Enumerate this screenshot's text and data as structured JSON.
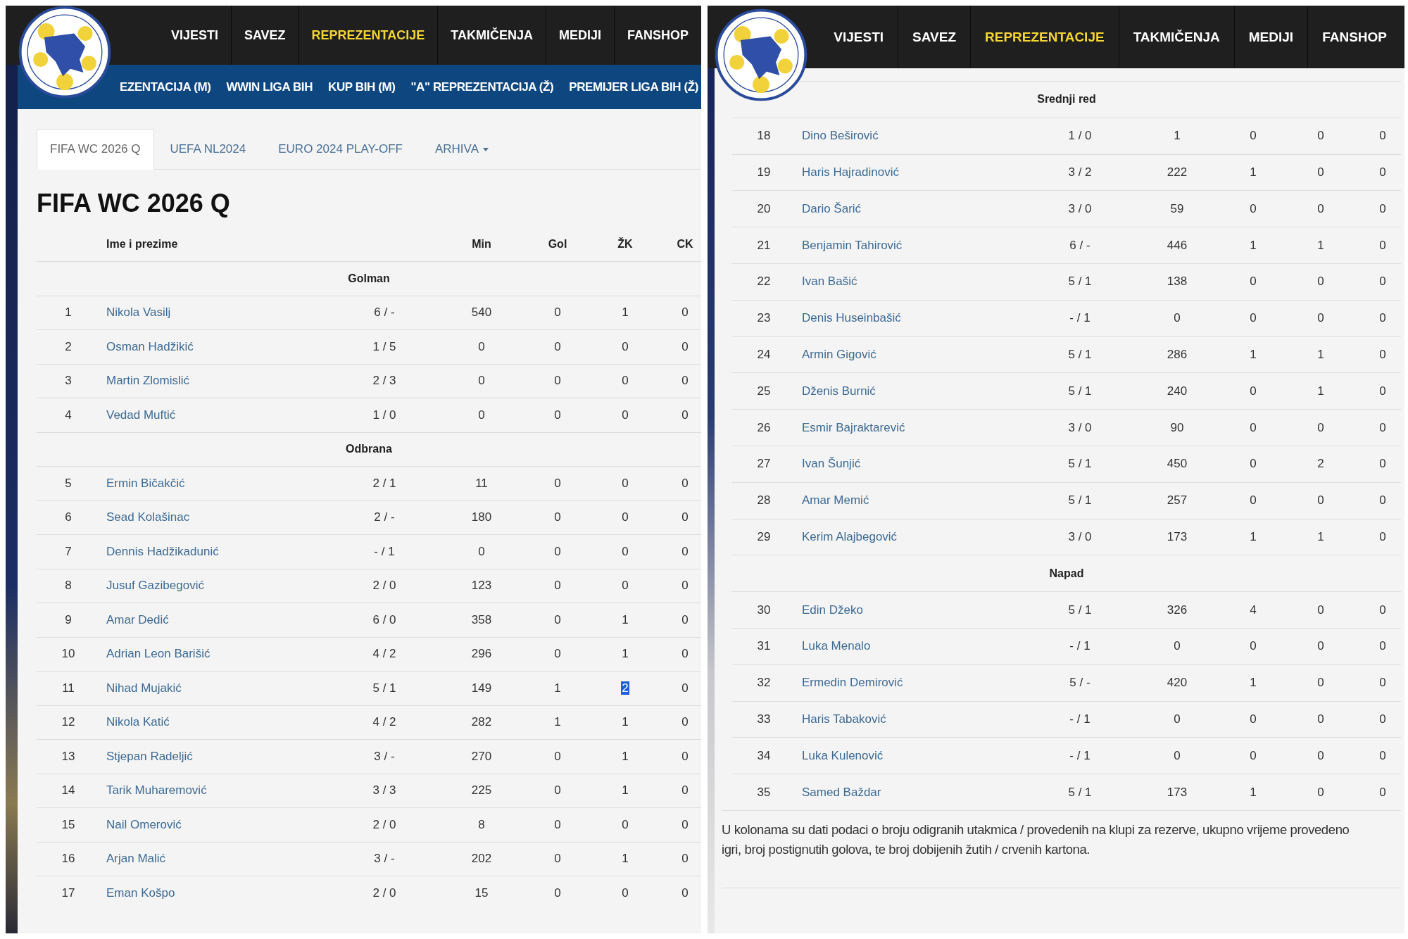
{
  "left_screenshot": {
    "nav": [
      {
        "label": "VIJESTI",
        "selected": false
      },
      {
        "label": "SAVEZ",
        "selected": false
      },
      {
        "label": "REPREZENTACIJE",
        "selected": true
      },
      {
        "label": "TAKMIČENJA",
        "selected": false
      },
      {
        "label": "MEDIJI",
        "selected": false
      },
      {
        "label": "FANSHOP",
        "selected": false
      }
    ],
    "subnav": [
      "EZENTACIJA (M)",
      "WWIN LIGA BIH",
      "KUP BIH (M)",
      "\"A\" REPREZENTACIJA (Ž)",
      "PREMIJER LIGA BIH (Ž)"
    ],
    "tabs": [
      {
        "label": "FIFA WC 2026 Q",
        "selected": true,
        "dropdown": false
      },
      {
        "label": "UEFA NL2024",
        "selected": false,
        "dropdown": false
      },
      {
        "label": "EURO 2024 PLAY-OFF",
        "selected": false,
        "dropdown": false
      },
      {
        "label": "ARHIVA",
        "selected": false,
        "dropdown": true
      }
    ],
    "title": "FIFA WC 2026 Q",
    "header": {
      "name": "Ime i prezime",
      "min": "Min",
      "gol": "Gol",
      "zk": "ŽK",
      "ck": "CK"
    },
    "sections": [
      {
        "heading": "Golman",
        "rows": [
          {
            "no": "1",
            "name": "Nikola Vasilj",
            "apps": "6 / -",
            "min": "540",
            "gol": "0",
            "zk": "1",
            "ck": "0",
            "zk_selected": false
          },
          {
            "no": "2",
            "name": "Osman Hadžikić",
            "apps": "1 / 5",
            "min": "0",
            "gol": "0",
            "zk": "0",
            "ck": "0",
            "zk_selected": false
          },
          {
            "no": "3",
            "name": "Martin Zlomislić",
            "apps": "2 / 3",
            "min": "0",
            "gol": "0",
            "zk": "0",
            "ck": "0",
            "zk_selected": false
          },
          {
            "no": "4",
            "name": "Vedad Muftić",
            "apps": "1 / 0",
            "min": "0",
            "gol": "0",
            "zk": "0",
            "ck": "0",
            "zk_selected": false
          }
        ]
      },
      {
        "heading": "Odbrana",
        "rows": [
          {
            "no": "5",
            "name": "Ermin Bičakčić",
            "apps": "2 / 1",
            "min": "11",
            "gol": "0",
            "zk": "0",
            "ck": "0",
            "zk_selected": false
          },
          {
            "no": "6",
            "name": "Sead Kolašinac",
            "apps": "2 / -",
            "min": "180",
            "gol": "0",
            "zk": "0",
            "ck": "0",
            "zk_selected": false
          },
          {
            "no": "7",
            "name": "Dennis Hadžikadunić",
            "apps": "- / 1",
            "min": "0",
            "gol": "0",
            "zk": "0",
            "ck": "0",
            "zk_selected": false
          },
          {
            "no": "8",
            "name": "Jusuf Gazibegović",
            "apps": "2 / 0",
            "min": "123",
            "gol": "0",
            "zk": "0",
            "ck": "0",
            "zk_selected": false
          },
          {
            "no": "9",
            "name": "Amar Dedić",
            "apps": "6 / 0",
            "min": "358",
            "gol": "0",
            "zk": "1",
            "ck": "0",
            "zk_selected": false
          },
          {
            "no": "10",
            "name": "Adrian Leon Barišić",
            "apps": "4 / 2",
            "min": "296",
            "gol": "0",
            "zk": "1",
            "ck": "0",
            "zk_selected": false
          },
          {
            "no": "11",
            "name": "Nihad Mujakić",
            "apps": "5 / 1",
            "min": "149",
            "gol": "1",
            "zk": "2",
            "ck": "0",
            "zk_selected": true
          },
          {
            "no": "12",
            "name": "Nikola Katić",
            "apps": "4 / 2",
            "min": "282",
            "gol": "1",
            "zk": "1",
            "ck": "0",
            "zk_selected": false
          },
          {
            "no": "13",
            "name": "Stjepan Radeljić",
            "apps": "3 / -",
            "min": "270",
            "gol": "0",
            "zk": "1",
            "ck": "0",
            "zk_selected": false
          },
          {
            "no": "14",
            "name": "Tarik Muharemović",
            "apps": "3 / 3",
            "min": "225",
            "gol": "0",
            "zk": "1",
            "ck": "0",
            "zk_selected": false
          },
          {
            "no": "15",
            "name": "Nail Omerović",
            "apps": "2 / 0",
            "min": "8",
            "gol": "0",
            "zk": "0",
            "ck": "0",
            "zk_selected": false
          },
          {
            "no": "16",
            "name": "Arjan Malić",
            "apps": "3 / -",
            "min": "202",
            "gol": "0",
            "zk": "1",
            "ck": "0",
            "zk_selected": false
          },
          {
            "no": "17",
            "name": "Eman Košpo",
            "apps": "2 / 0",
            "min": "15",
            "gol": "0",
            "zk": "0",
            "ck": "0",
            "zk_selected": false
          }
        ]
      }
    ]
  },
  "right_screenshot": {
    "nav": [
      {
        "label": "VIJESTI",
        "selected": false
      },
      {
        "label": "SAVEZ",
        "selected": false
      },
      {
        "label": "REPREZENTACIJE",
        "selected": true
      },
      {
        "label": "TAKMIČENJA",
        "selected": false
      },
      {
        "label": "MEDIJI",
        "selected": false
      },
      {
        "label": "FANSHOP",
        "selected": false
      }
    ],
    "sections": [
      {
        "heading": "Srednji red",
        "rows": [
          {
            "no": "18",
            "name": "Dino Beširović",
            "apps": "1 / 0",
            "min": "1",
            "gol": "0",
            "zk": "0",
            "ck": "0",
            "zk_selected": false
          },
          {
            "no": "19",
            "name": "Haris Hajradinović",
            "apps": "3 / 2",
            "min": "222",
            "gol": "1",
            "zk": "0",
            "ck": "0",
            "zk_selected": false
          },
          {
            "no": "20",
            "name": "Dario Šarić",
            "apps": "3 / 0",
            "min": "59",
            "gol": "0",
            "zk": "0",
            "ck": "0",
            "zk_selected": false
          },
          {
            "no": "21",
            "name": "Benjamin Tahirović",
            "apps": "6 / -",
            "min": "446",
            "gol": "1",
            "zk": "1",
            "ck": "0",
            "zk_selected": false
          },
          {
            "no": "22",
            "name": "Ivan Bašić",
            "apps": "5 / 1",
            "min": "138",
            "gol": "0",
            "zk": "0",
            "ck": "0",
            "zk_selected": false
          },
          {
            "no": "23",
            "name": "Denis Huseinbašić",
            "apps": "- / 1",
            "min": "0",
            "gol": "0",
            "zk": "0",
            "ck": "0",
            "zk_selected": false
          },
          {
            "no": "24",
            "name": "Armin Gigović",
            "apps": "5 / 1",
            "min": "286",
            "gol": "1",
            "zk": "1",
            "ck": "0",
            "zk_selected": false
          },
          {
            "no": "25",
            "name": "Dženis Burnić",
            "apps": "5 / 1",
            "min": "240",
            "gol": "0",
            "zk": "1",
            "ck": "0",
            "zk_selected": false
          },
          {
            "no": "26",
            "name": "Esmir Bajraktarević",
            "apps": "3 / 0",
            "min": "90",
            "gol": "0",
            "zk": "0",
            "ck": "0",
            "zk_selected": false
          },
          {
            "no": "27",
            "name": "Ivan Šunjić",
            "apps": "5 / 1",
            "min": "450",
            "gol": "0",
            "zk": "2",
            "ck": "0",
            "zk_selected": false
          },
          {
            "no": "28",
            "name": "Amar Memić",
            "apps": "5 / 1",
            "min": "257",
            "gol": "0",
            "zk": "0",
            "ck": "0",
            "zk_selected": false
          },
          {
            "no": "29",
            "name": "Kerim Alajbegović",
            "apps": "3 / 0",
            "min": "173",
            "gol": "1",
            "zk": "1",
            "ck": "0",
            "zk_selected": false
          }
        ]
      },
      {
        "heading": "Napad",
        "rows": [
          {
            "no": "30",
            "name": "Edin Džeko",
            "apps": "5 / 1",
            "min": "326",
            "gol": "4",
            "zk": "0",
            "ck": "0",
            "zk_selected": false
          },
          {
            "no": "31",
            "name": "Luka Menalo",
            "apps": "- / 1",
            "min": "0",
            "gol": "0",
            "zk": "0",
            "ck": "0",
            "zk_selected": false
          },
          {
            "no": "32",
            "name": "Ermedin Demirović",
            "apps": "5 / -",
            "min": "420",
            "gol": "1",
            "zk": "0",
            "ck": "0",
            "zk_selected": false
          },
          {
            "no": "33",
            "name": "Haris Tabaković",
            "apps": "- / 1",
            "min": "0",
            "gol": "0",
            "zk": "0",
            "ck": "0",
            "zk_selected": false
          },
          {
            "no": "34",
            "name": "Luka Kulenović",
            "apps": "- / 1",
            "min": "0",
            "gol": "0",
            "zk": "0",
            "ck": "0",
            "zk_selected": false
          },
          {
            "no": "35",
            "name": "Samed Baždar",
            "apps": "5 / 1",
            "min": "173",
            "gol": "1",
            "zk": "0",
            "ck": "0",
            "zk_selected": false
          }
        ]
      }
    ],
    "footnote_lines": [
      "U kolonama su dati podaci o broju odigranih utakmica / provedenih na klupi za rezerve, ukupno vrijeme provedeno",
      "igri, broj postignutih golova, te broj dobijenih žutih / crvenih kartona."
    ]
  }
}
